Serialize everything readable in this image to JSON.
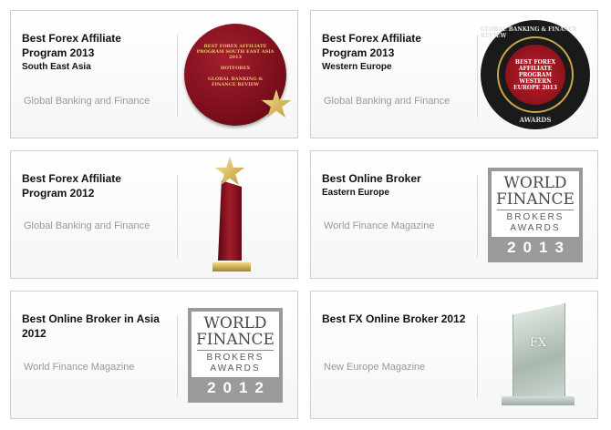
{
  "awards": [
    {
      "title": "Best Forex Affiliate Program 2013",
      "subtitle": "South East Asia",
      "source": "Global Banking and Finance"
    },
    {
      "title": "Best Forex Affiliate Program 2013",
      "subtitle": "Western Europe",
      "source": "Global Banking and Finance"
    },
    {
      "title": "Best Forex Affiliate Program 2012",
      "subtitle": "",
      "source": "Global Banking and Finance"
    },
    {
      "title": "Best Online Broker",
      "subtitle": "Eastern Europe",
      "source": "World Finance Magazine"
    },
    {
      "title": "Best Online Broker in Asia 2012",
      "subtitle": "",
      "source": "World Finance Magazine"
    },
    {
      "title": "Best FX Online Broker 2012",
      "subtitle": "",
      "source": "New Europe Magazine"
    }
  ],
  "images": {
    "plaque_sea": {
      "icon": "award-plaque-icon",
      "heading": "BEST FOREX AFFILIATE PROGRAM SOUTH EAST ASIA 2013",
      "company": "HOTFOREX",
      "issuer": "GLOBAL BANKING & FINANCE REVIEW"
    },
    "seal_we": {
      "icon": "award-seal-icon",
      "inner": "BEST FOREX AFFILIATE PROGRAM WESTERN EUROPE 2013",
      "ring_top": "GLOBAL BANKING & FINANCE REVIEW",
      "ring_bottom": "AWARDS"
    },
    "trophy_2012": {
      "icon": "star-trophy-icon"
    },
    "wf_2013": {
      "icon": "world-finance-badge-icon",
      "line1": "WORLD",
      "line2": "FINANCE",
      "line3": "BROKERS",
      "line4": "AWARDS",
      "year": "2013"
    },
    "wf_2012": {
      "icon": "world-finance-badge-icon",
      "line1": "WORLD",
      "line2": "FINANCE",
      "line3": "BROKERS",
      "line4": "AWARDS",
      "year": "2012"
    },
    "glass_2012": {
      "icon": "glass-award-icon",
      "mark": "FX"
    }
  },
  "colors": {
    "card_border": "#cfcfcf",
    "source_text": "#999999",
    "badge_gray": "#9a9a9a",
    "award_red": "#a41e2d",
    "award_gold": "#c9a54a"
  }
}
